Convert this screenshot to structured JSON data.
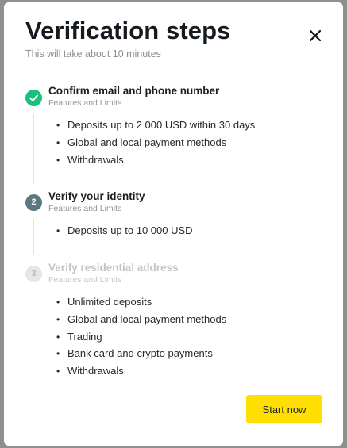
{
  "modal": {
    "title": "Verification steps",
    "subtitle": "This will take about 10 minutes",
    "close_icon": "close-icon"
  },
  "steps": [
    {
      "status": "done",
      "icon": "checkmark-icon",
      "title": "Confirm email and phone number",
      "subtitle": "Features and Limits",
      "features": [
        "Deposits up to 2 000 USD within 30 days",
        "Global and local payment methods",
        "Withdrawals"
      ]
    },
    {
      "status": "current",
      "number": "2",
      "title": "Verify your identity",
      "subtitle": "Features and Limits",
      "features": [
        "Deposits up to 10 000 USD"
      ]
    },
    {
      "status": "pending",
      "number": "3",
      "title": "Verify residential address",
      "subtitle": "Features and Limits",
      "features": [
        "Unlimited deposits",
        "Global and local payment methods",
        "Trading",
        "Bank card and crypto payments",
        "Withdrawals"
      ]
    }
  ],
  "bullet": "•",
  "actions": {
    "start_label": "Start now"
  },
  "colors": {
    "done": "#19bf7d",
    "current": "#5d7781",
    "pending": "#e4e6e8",
    "button": "#ffde02",
    "backdrop": "#8f8f8f"
  }
}
